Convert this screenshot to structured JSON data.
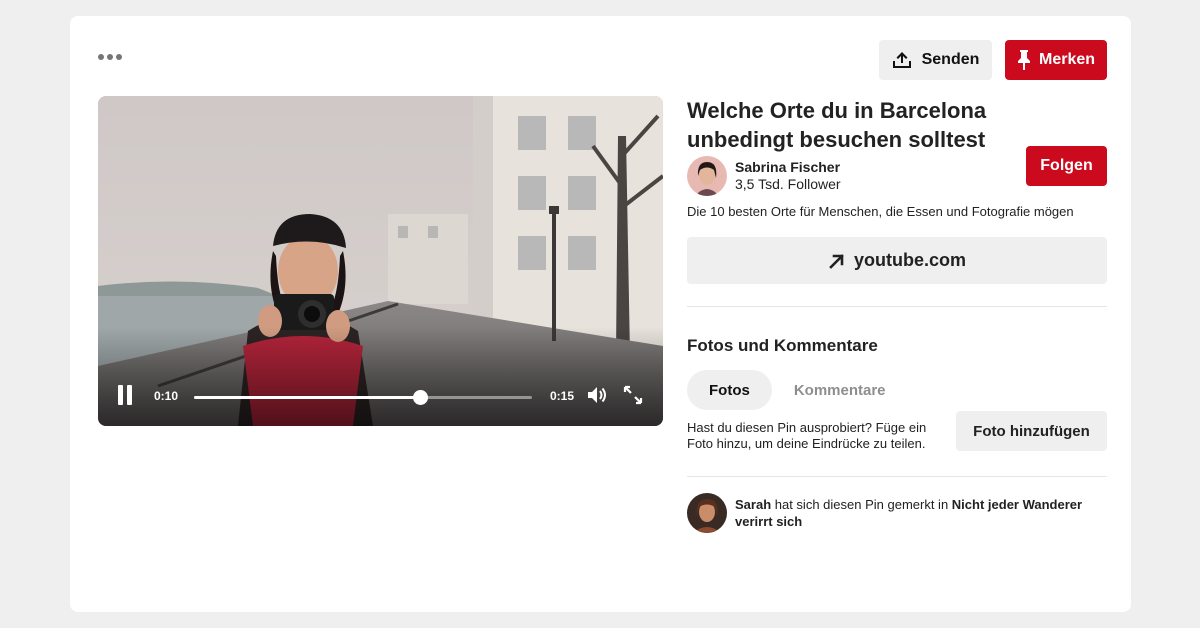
{
  "toolbar": {
    "send_label": "Senden",
    "save_label": "Merken",
    "more_icon": "more-dots-icon"
  },
  "video": {
    "current_time": "0:10",
    "duration": "0:15",
    "progress": 0.67
  },
  "pin": {
    "title": "Welche Orte du in Barcelona unbedingt besuchen solltest",
    "author_name": "Sabrina Fischer",
    "author_followers": "3,5 Tsd. Follower",
    "follow_label": "Folgen",
    "description": "Die 10 besten Orte für Menschen, die Essen und Fotografie mögen",
    "link_label": "youtube.com"
  },
  "comments": {
    "section_title": "Fotos und Kommentare",
    "tabs": [
      {
        "label": "Fotos",
        "active": true
      },
      {
        "label": "Kommentare",
        "active": false
      }
    ],
    "prompt": "Hast du diesen Pin ausprobiert? Füge ein Foto hinzu, um deine Eindrücke zu teilen.",
    "add_photo_label": "Foto hinzufügen"
  },
  "activity": {
    "user": "Sarah",
    "text": " hat sich diesen Pin gemerkt in ",
    "board": "Nicht jeder Wanderer verirrt sich"
  },
  "colors": {
    "brand_red": "#cc0a1e",
    "button_gray": "#efefef",
    "background": "#efefef"
  }
}
